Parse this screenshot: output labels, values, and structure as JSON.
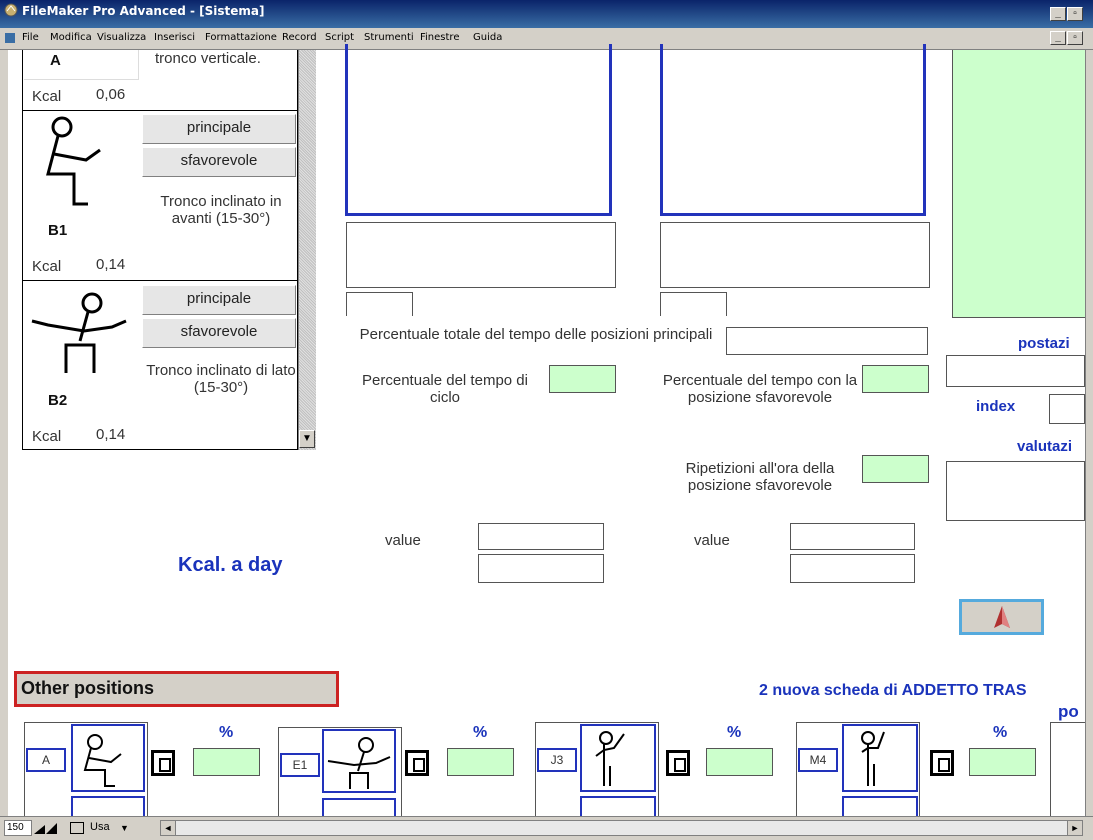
{
  "window": {
    "title": "FileMaker Pro Advanced - [Sistema]"
  },
  "menu": [
    "File",
    "Modifica",
    "Visualizza",
    "Inserisci",
    "Formattazione",
    "Record",
    "Script",
    "Strumenti",
    "Finestre",
    "Guida"
  ],
  "portal": {
    "row_a": {
      "code": "A",
      "kcal_label": "Kcal",
      "kcal_value": "0,06",
      "desc": "tronco verticale."
    },
    "row_b1": {
      "code": "B1",
      "kcal_label": "Kcal",
      "kcal_value": "0,14",
      "btn_main": "principale",
      "btn_unfav": "sfavorevole",
      "desc": "Tronco inclinato in avanti  (15-30°)"
    },
    "row_b2": {
      "code": "B2",
      "kcal_label": "Kcal",
      "kcal_value": "0,14",
      "btn_main": "principale",
      "btn_unfav": "sfavorevole",
      "desc": "Tronco inclinato di lato  (15-30°)"
    }
  },
  "labels": {
    "perc_total": "Percentuale totale del tempo delle posizioni principali",
    "perc_cycle": "Percentuale del tempo di ciclo",
    "perc_unfav": "Percentuale del tempo con la posizione sfavorevole",
    "rep_hour": "Ripetizioni all'ora della posizione sfavorevole",
    "value1": "value",
    "value2": "value",
    "kcal_day": "Kcal. a day",
    "postazi": "postazi",
    "index": "index",
    "valutazi": "valutazi",
    "other_positions": "Other positions",
    "nuova_scheda": "2  nuova scheda di ADDETTO TRAS",
    "po": "po"
  },
  "bottom_cards": [
    {
      "code": "A",
      "pct": "%"
    },
    {
      "code": "E1",
      "pct": "%"
    },
    {
      "code": "J3",
      "pct": "%"
    },
    {
      "code": "M4",
      "pct": "%"
    }
  ],
  "status": {
    "zoom": "150",
    "mode": "Usa"
  },
  "colors": {
    "accent_blue": "#1a33bb",
    "field_green": "#ccffcc",
    "panel_green": "#ccffcc",
    "other_border": "#cc2222"
  }
}
